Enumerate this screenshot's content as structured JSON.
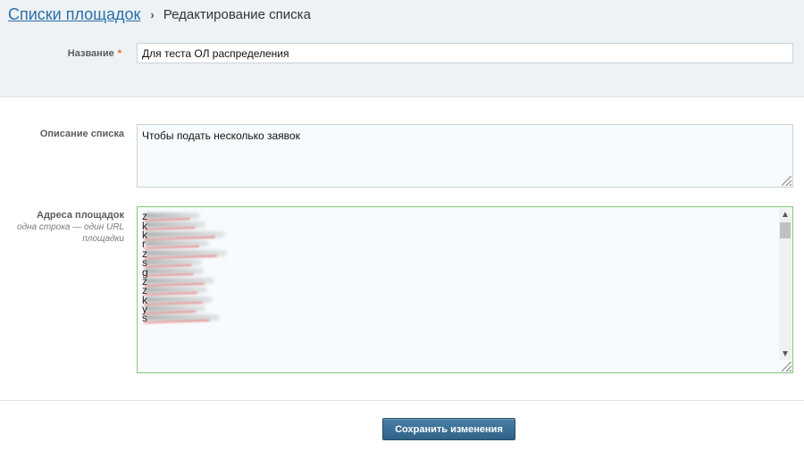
{
  "breadcrumb": {
    "parent": "Списки площадок",
    "separator": "›",
    "current": "Редактирование списка"
  },
  "fields": {
    "name": {
      "label": "Название",
      "required_mark": "*",
      "value": "Для теста ОЛ распределения"
    },
    "description": {
      "label": "Описание списка",
      "value": "Чтобы подать несколько заявок"
    },
    "sites": {
      "label": "Адреса площадок",
      "hint": "одна строка — один URL площадки",
      "visible_first_chars": [
        "z",
        "k",
        "k",
        "r",
        "z",
        "s",
        "g",
        "z",
        "z",
        "k",
        "y",
        "s"
      ]
    }
  },
  "actions": {
    "save_label": "Сохранить изменения"
  },
  "icons": {
    "scroll_up": "chevron-up-icon",
    "scroll_down": "chevron-down-icon"
  },
  "colors": {
    "link": "#2a6fa8",
    "accent": "#2f6286",
    "required": "#e26a1c",
    "active_border": "#86c57a"
  }
}
